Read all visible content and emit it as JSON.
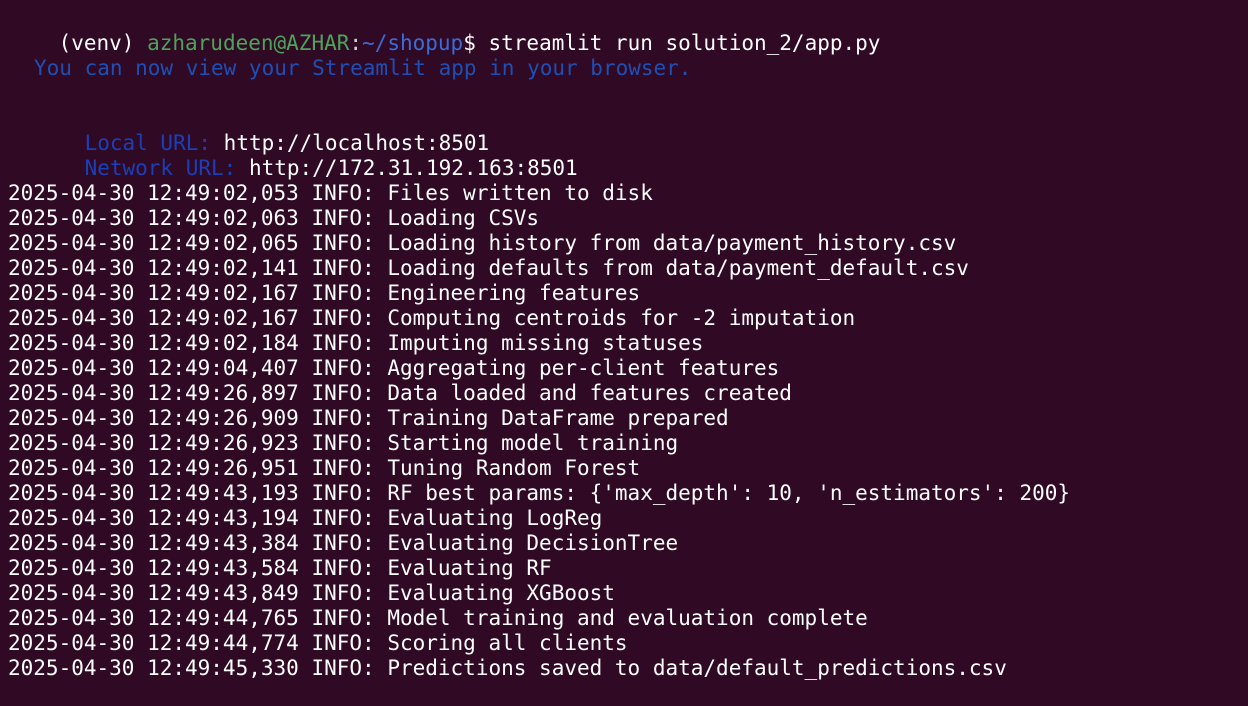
{
  "prompt": {
    "env": "(venv) ",
    "user_host": "azharudeen@AZHAR",
    "colon": ":",
    "path": "~/shopup",
    "dollar": "$",
    "command": " streamlit run solution_2/app.py"
  },
  "streamlit": {
    "view_message": "You can now view your Streamlit app in your browser.",
    "local_label": "Local URL:",
    "local_url": "http://localhost:8501",
    "network_label": "Network URL:",
    "network_url": "http://172.31.192.163:8501"
  },
  "log_lines": [
    {
      "ts": "2025-04-30 12:49:02,053",
      "level": "INFO:",
      "msg": "Files written to disk"
    },
    {
      "ts": "2025-04-30 12:49:02,063",
      "level": "INFO:",
      "msg": "Loading CSVs"
    },
    {
      "ts": "2025-04-30 12:49:02,065",
      "level": "INFO:",
      "msg": "Loading history from data/payment_history.csv"
    },
    {
      "ts": "2025-04-30 12:49:02,141",
      "level": "INFO:",
      "msg": "Loading defaults from data/payment_default.csv"
    },
    {
      "ts": "2025-04-30 12:49:02,167",
      "level": "INFO:",
      "msg": "Engineering features"
    },
    {
      "ts": "2025-04-30 12:49:02,167",
      "level": "INFO:",
      "msg": "Computing centroids for -2 imputation"
    },
    {
      "ts": "2025-04-30 12:49:02,184",
      "level": "INFO:",
      "msg": "Imputing missing statuses"
    },
    {
      "ts": "2025-04-30 12:49:04,407",
      "level": "INFO:",
      "msg": "Aggregating per-client features"
    },
    {
      "ts": "2025-04-30 12:49:26,897",
      "level": "INFO:",
      "msg": "Data loaded and features created"
    },
    {
      "ts": "2025-04-30 12:49:26,909",
      "level": "INFO:",
      "msg": "Training DataFrame prepared"
    },
    {
      "ts": "2025-04-30 12:49:26,923",
      "level": "INFO:",
      "msg": "Starting model training"
    },
    {
      "ts": "2025-04-30 12:49:26,951",
      "level": "INFO:",
      "msg": "Tuning Random Forest"
    },
    {
      "ts": "2025-04-30 12:49:43,193",
      "level": "INFO:",
      "msg": "RF best params: {'max_depth': 10, 'n_estimators': 200}"
    },
    {
      "ts": "2025-04-30 12:49:43,194",
      "level": "INFO:",
      "msg": "Evaluating LogReg"
    },
    {
      "ts": "2025-04-30 12:49:43,384",
      "level": "INFO:",
      "msg": "Evaluating DecisionTree"
    },
    {
      "ts": "2025-04-30 12:49:43,584",
      "level": "INFO:",
      "msg": "Evaluating RF"
    },
    {
      "ts": "2025-04-30 12:49:43,849",
      "level": "INFO:",
      "msg": "Evaluating XGBoost"
    },
    {
      "ts": "2025-04-30 12:49:44,765",
      "level": "INFO:",
      "msg": "Model training and evaluation complete"
    },
    {
      "ts": "2025-04-30 12:49:44,774",
      "level": "INFO:",
      "msg": "Scoring all clients"
    },
    {
      "ts": "2025-04-30 12:49:45,330",
      "level": "INFO:",
      "msg": "Predictions saved to data/default_predictions.csv"
    }
  ],
  "colors": {
    "background": "#300a24",
    "prompt_user": "#4ea35a",
    "prompt_path": "#3b6bd6",
    "streamlit_blue": "#1a3fb8",
    "text": "#ffffff"
  }
}
